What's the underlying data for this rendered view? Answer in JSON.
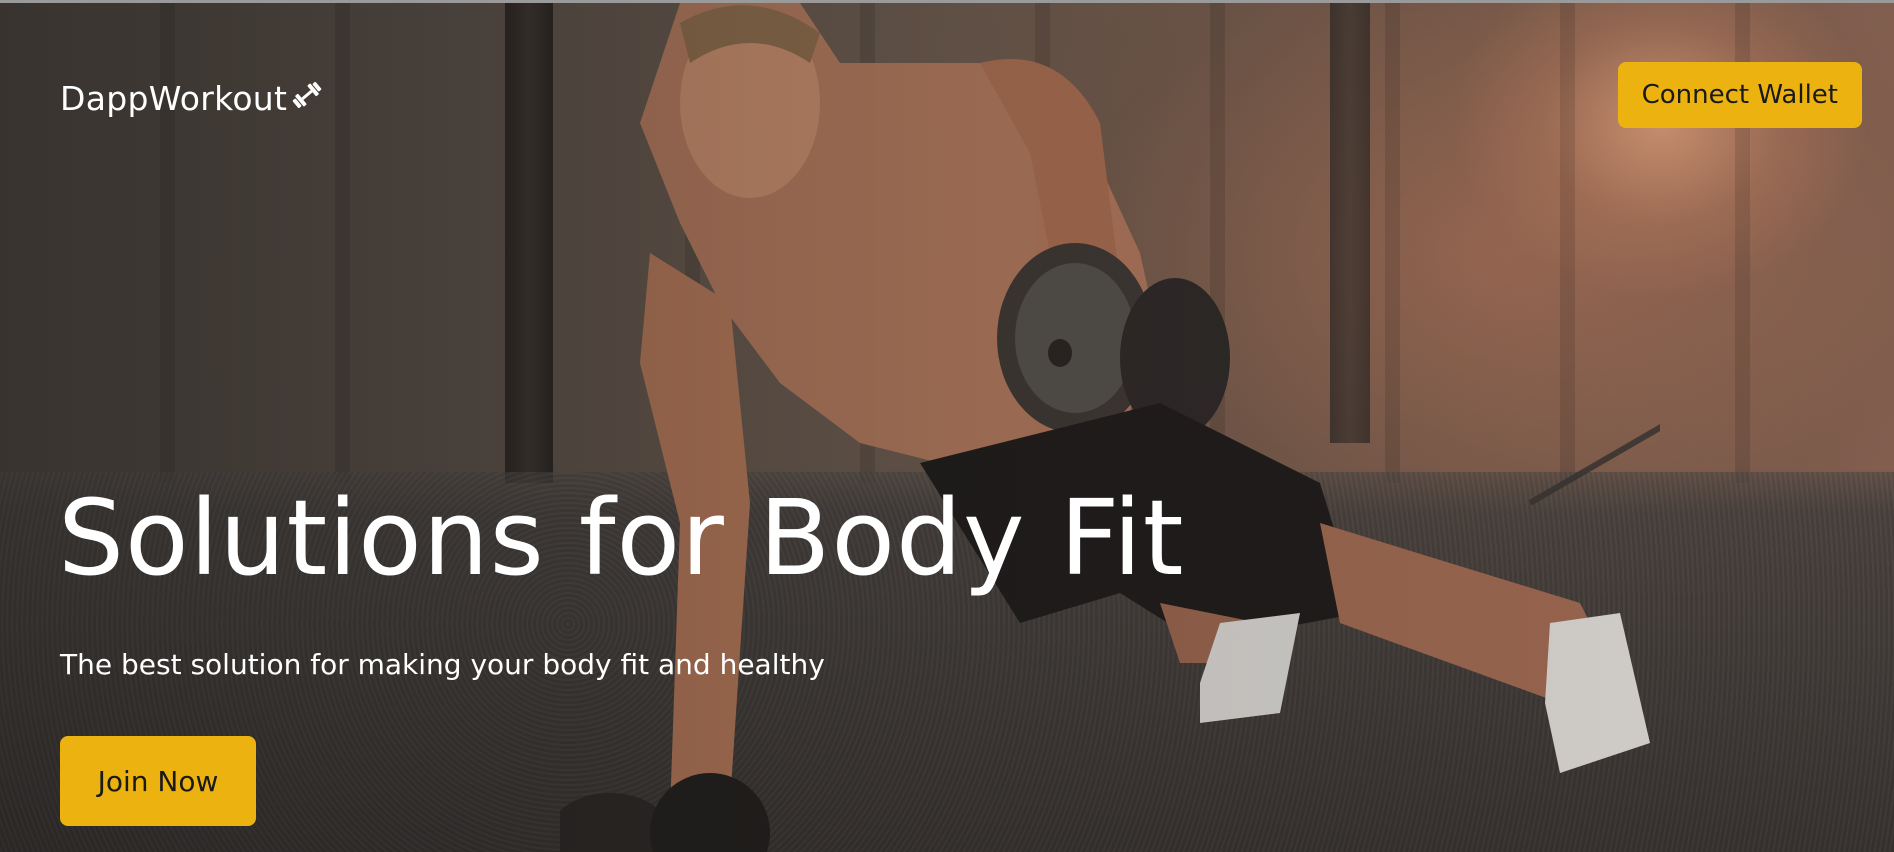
{
  "navbar": {
    "brand": "DappWorkout",
    "brand_icon": "dumbbell-icon",
    "connect_label": "Connect Wallet"
  },
  "hero": {
    "title": "Solutions for Body Fit",
    "subtitle": "The best solution for making your body fit and healthy",
    "cta_label": "Join Now"
  },
  "colors": {
    "accent": "#ecb310",
    "text": "#ffffff"
  }
}
